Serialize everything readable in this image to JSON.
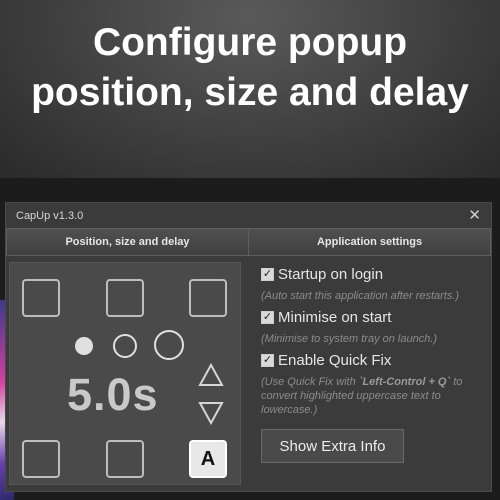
{
  "banner": {
    "line1": "Configure popup",
    "line2": "position, size and delay"
  },
  "window": {
    "title": "CapUp v1.3.0",
    "close_glyph": "✕"
  },
  "tabs": [
    {
      "label": "Position, size and delay"
    },
    {
      "label": "Application settings"
    }
  ],
  "left_panel": {
    "delay": "5.0s",
    "active_position_label": "A",
    "selected_size_index": 0,
    "up_icon": "triangle-up-icon",
    "down_icon": "triangle-down-icon"
  },
  "settings": {
    "startup": {
      "label": "Startup on login",
      "checked": true,
      "hint": "(Auto start this application after restarts.)"
    },
    "minimise": {
      "label": "Minimise on start",
      "checked": true,
      "hint": "(Minimise to system tray on launch.)"
    },
    "quickfix": {
      "label": "Enable Quick Fix",
      "checked": true,
      "hint_pre": "(Use Quick Fix with ",
      "hint_key": "`Left-Control + Q`",
      "hint_post": " to convert highlighted uppercase text to lowercase.)"
    },
    "check_glyph": "✓"
  },
  "extra_button": {
    "label": "Show Extra Info"
  }
}
